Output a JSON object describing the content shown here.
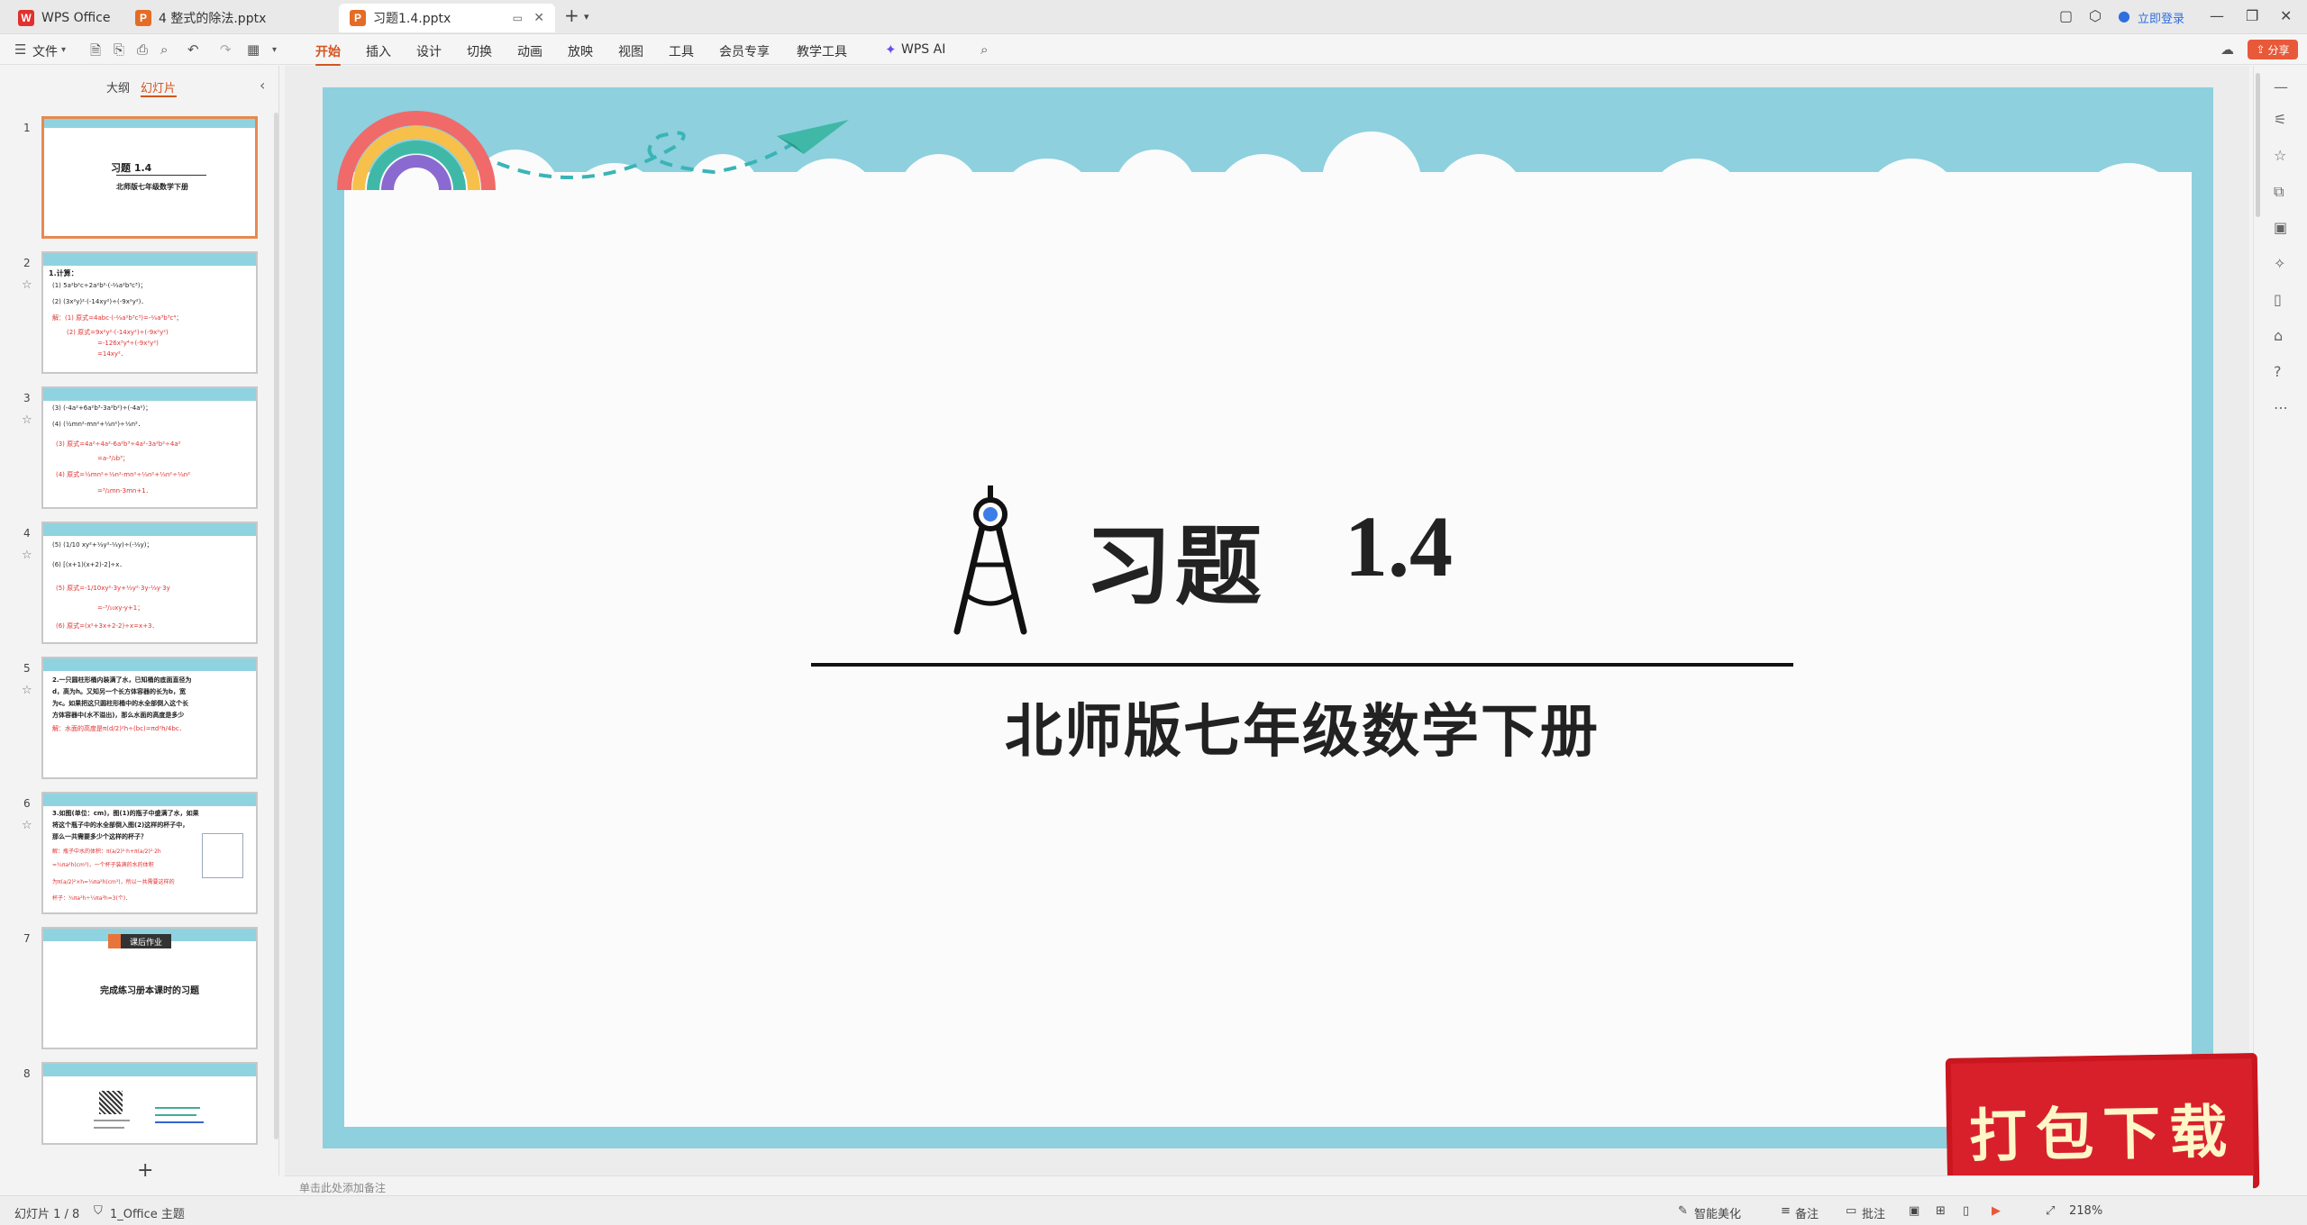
{
  "tabs": [
    {
      "label": "WPS Office",
      "icon": "wps-logo-icon"
    },
    {
      "label": "4  整式的除法.pptx",
      "icon": "ppt-file-icon"
    },
    {
      "label": "习题1.4.pptx",
      "icon": "ppt-file-icon"
    }
  ],
  "titlebar": {
    "login_label": "立即登录"
  },
  "toolbar": {
    "file_label": "文件",
    "menu": [
      "开始",
      "插入",
      "设计",
      "切换",
      "动画",
      "放映",
      "视图",
      "工具",
      "会员专享",
      "教学工具"
    ],
    "wps_ai_label": "WPS AI",
    "share_label": "分享"
  },
  "left_panel": {
    "tab_outline": "大纲",
    "tab_slides": "幻灯片",
    "add_label": "+"
  },
  "thumbnails": [
    {
      "num": "1",
      "title": "习题   1.4",
      "subtitle": "北师版七年级数学下册"
    },
    {
      "num": "2",
      "lines": [
        "1.计算：",
        "(1) 5a²b²c÷2a²b²·(-⅔a²b³c³)；",
        "(2) (3x²y)²·(-14xy²)÷(-9x²y²)．",
        "解：(1) 原式=4abc·(-⅔a²b³c³)=-⅔a³b³c⁴；",
        "(2) 原式=9x²y²·(-14xy²)÷(-9x²y²)",
        "=-126x³y⁴÷(-9x²y²)",
        "=14xy²．"
      ]
    },
    {
      "num": "3",
      "lines": [
        "(3) (-4a²+6a²b³-3a²b²)÷(-4a²)；",
        "(4) (½mn²-mn²+⅓n²)÷⅓n²．",
        "(3) 原式=4a²÷4a²-6a²b³÷4a²-3a²b²÷4a²",
        "=a-³/₂b³；",
        "(4) 原式=½mn²÷⅓n²-mn²÷⅓n²+⅓n²÷⅓n²",
        "=³/₂mn-3mn+1．"
      ]
    },
    {
      "num": "4",
      "lines": [
        "(5) (1/10 xy²+⅓y²-⅓y)÷(-⅓y)；",
        "(6) [(x+1)(x+2)-2]÷x．",
        "(5) 原式=-1/10xy²·3y+⅓y²·3y-⅓y·3y",
        "=-³/₁₀xy-y+1；",
        "(6) 原式=(x²+3x+2-2)÷x=x+3．"
      ]
    },
    {
      "num": "5",
      "lines": [
        "2.一只圆柱形桶内装满了水，已知桶的底面直径为",
        "d，高为h。又知另一个长方体容器的长为b，宽",
        "为c。如果把这只圆柱形桶中的水全部倒入这个长",
        "方体容器中(水不溢出)，那么水面的高度是多少",
        "解：水面的高度是π(d/2)²h÷(bc)=πd²h/4bc．"
      ]
    },
    {
      "num": "6",
      "lines": [
        "3.如图(单位：cm)，图(1)的瓶子中盛满了水，如果",
        "将这个瓶子中的水全部倒入图(2)这样的杯子中，",
        "那么一共需要多少个这样的杯子？",
        "解：瓶子中水的体积：π(a/2)²·h+π(a/2)²·2h",
        "=¾πa²h(cm³)，一个杯子装满的水的体积",
        "为π(a/2)²×h=¼πa²h(cm³)，所以一共需要这样的",
        "杯子：¾πa²h÷¼πa²h=3(个)．"
      ]
    },
    {
      "num": "7",
      "badge": "课后作业",
      "text": "完成练习册本课时的习题"
    },
    {
      "num": "8"
    }
  ],
  "slide": {
    "title_word": "习题",
    "title_num": "1.4",
    "subtitle": "北师版七年级数学下册"
  },
  "watermark": {
    "text": "打包下载"
  },
  "notes_placeholder": "单击此处添加备注",
  "statusbar": {
    "slide_info": "幻灯片 1 / 8",
    "theme": "1_Office 主题",
    "smart_beautify": "智能美化",
    "notes": "备注",
    "comments": "批注",
    "zoom": "218%"
  },
  "colors": {
    "accent": "#d4541f",
    "slide_frame": "#8ed0de",
    "watermark_bg": "#d8202a"
  }
}
